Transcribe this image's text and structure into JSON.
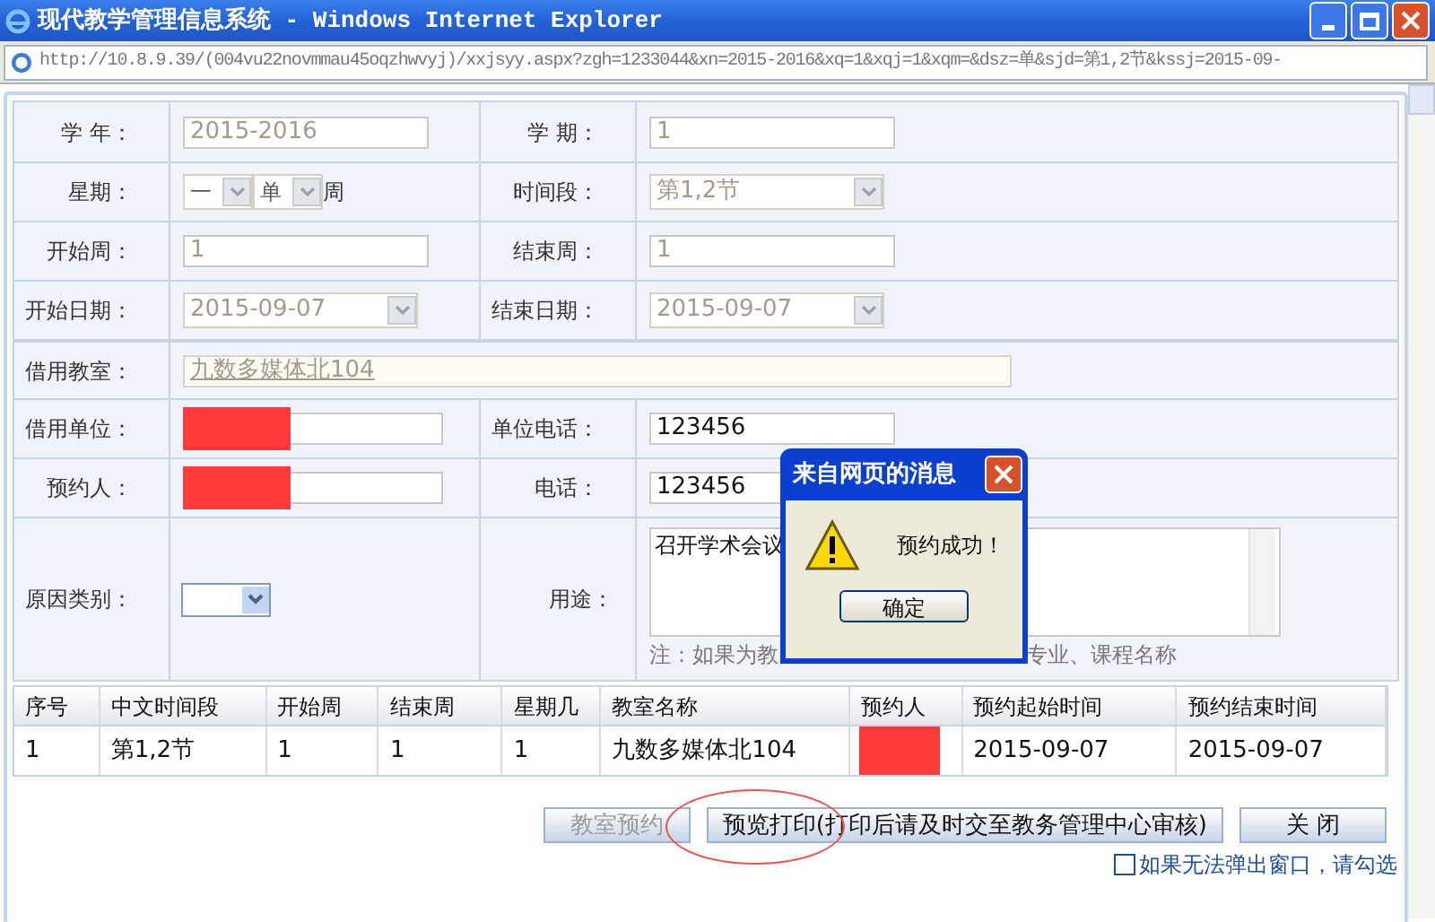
{
  "window": {
    "title": "现代教学管理信息系统 - Windows Internet Explorer"
  },
  "address_bar": {
    "url": "http://10.8.9.39/(004vu22novmmau45oqzhwvyj)/xxjsyy.aspx?zgh=1233044&xn=2015-2016&xq=1&xqj=1&xqm=&dsz=单&sjd=第1,2节&kssj=2015-09-"
  },
  "form": {
    "rows": [
      [
        {
          "label": "学 年：",
          "kind": "text",
          "value": "2015-2016",
          "disabled": true
        },
        {
          "label": "学 期：",
          "kind": "text",
          "value": "1",
          "disabled": true
        }
      ],
      [
        {
          "label": "星期：",
          "kind": "week",
          "day": "一",
          "parity": "单",
          "suffix": "周"
        },
        {
          "label": "时间段：",
          "kind": "select",
          "value": "第1,2节",
          "disabled": true
        }
      ],
      [
        {
          "label": "开始周：",
          "kind": "text",
          "value": "1",
          "disabled": true
        },
        {
          "label": "结束周：",
          "kind": "text",
          "value": "1",
          "disabled": true
        }
      ],
      [
        {
          "label": "开始日期：",
          "kind": "select",
          "value": "2015-09-07",
          "disabled": true
        },
        {
          "label": "结束日期：",
          "kind": "select",
          "value": "2015-09-07",
          "disabled": true
        }
      ],
      [
        {
          "label": "借用教室：",
          "kind": "wide",
          "value": "九数多媒体北104"
        }
      ],
      [
        {
          "label": "借用单位：",
          "kind": "redacted"
        },
        {
          "label": "单位电话：",
          "kind": "text",
          "value": "123456",
          "disabled": false
        }
      ],
      [
        {
          "label": "预约人：",
          "kind": "redacted"
        },
        {
          "label": "电话：",
          "kind": "text",
          "value": "123456",
          "disabled": false
        }
      ]
    ],
    "reason": {
      "label": "原因类别：",
      "purpose_label": "用途：",
      "purpose": "召开学术会议",
      "note_parts": [
        "注：如果为教",
        "专业、课程名称"
      ]
    }
  },
  "table": {
    "columns": [
      "序号",
      "中文时间段",
      "开始周",
      "结束周",
      "星期几",
      "教室名称",
      "预约人",
      "预约起始时间",
      "预约结束时间"
    ],
    "rows": [
      {
        "cells": [
          {
            "kind": "text",
            "text": "1"
          },
          {
            "kind": "text",
            "text": "第1,2节"
          },
          {
            "kind": "text",
            "text": "1"
          },
          {
            "kind": "text",
            "text": "1"
          },
          {
            "kind": "text",
            "text": "1"
          },
          {
            "kind": "text",
            "text": "九数多媒体北104"
          },
          {
            "kind": "redacted"
          },
          {
            "kind": "text",
            "text": "2015-09-07"
          },
          {
            "kind": "text",
            "text": "2015-09-07"
          }
        ]
      }
    ]
  },
  "buttons": [
    {
      "label": "教室预约",
      "disabled": true,
      "circled": false
    },
    {
      "label": "预览打印(打印后请及时交至教务管理中心审核)",
      "disabled": false,
      "circled": true
    },
    {
      "label": "关  闭",
      "disabled": false,
      "circled": false
    }
  ],
  "popup_checkbox": {
    "label": "如果无法弹出窗口，请勾选",
    "checked": false
  },
  "dialog": {
    "title": "来自网页的消息",
    "message": "预约成功！",
    "button": "确定"
  }
}
